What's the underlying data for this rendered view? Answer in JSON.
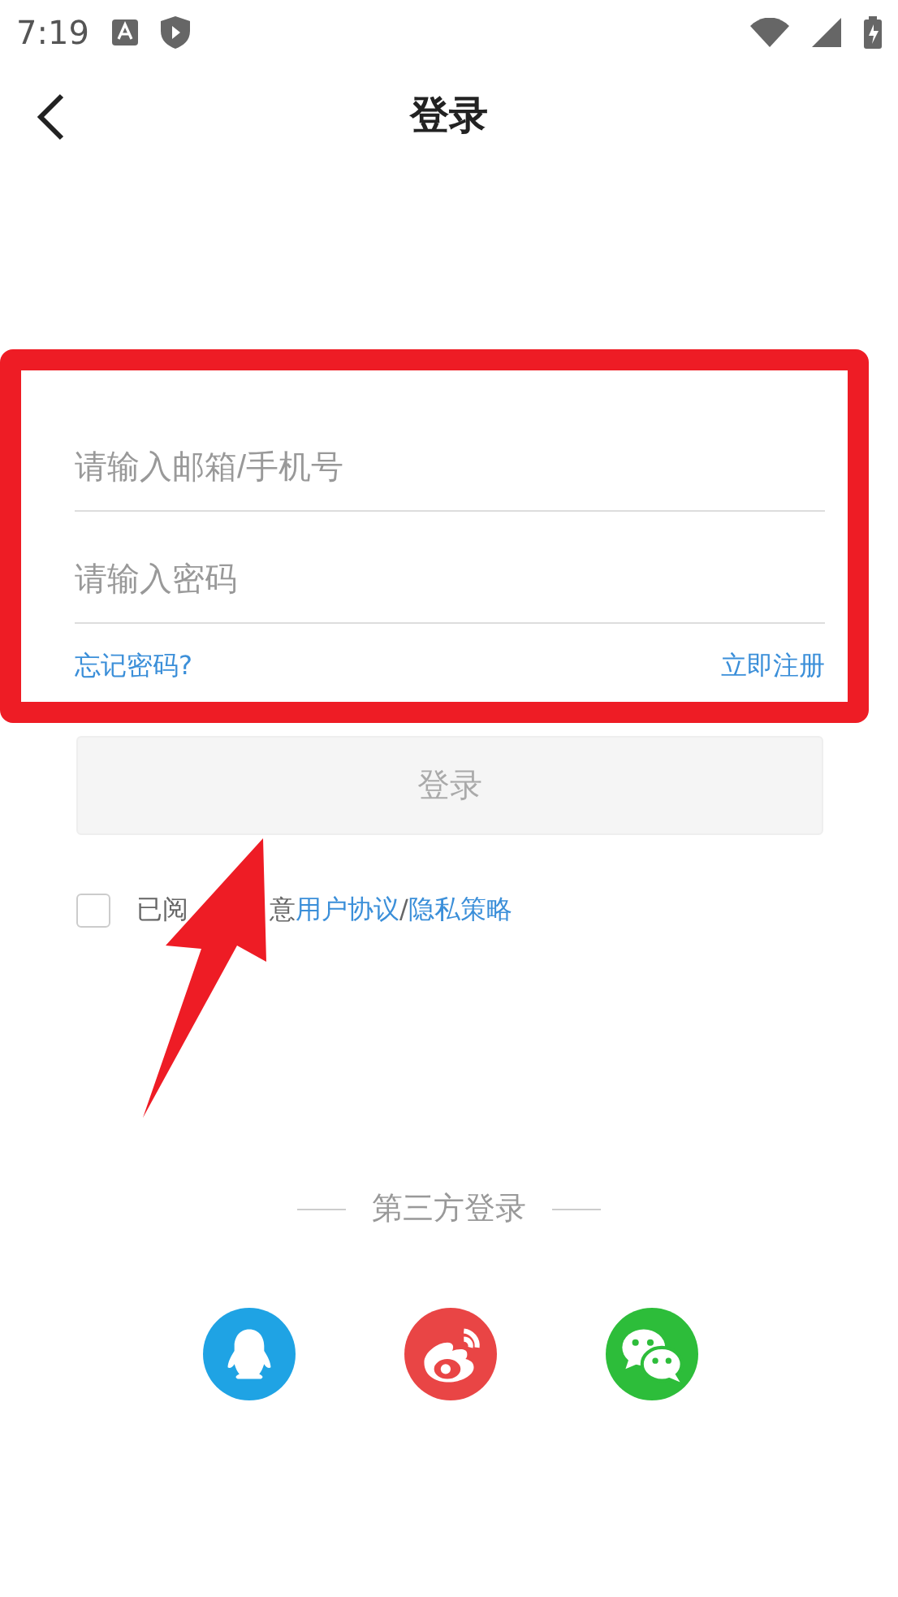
{
  "status_bar": {
    "time": "7:19"
  },
  "header": {
    "title": "登录"
  },
  "form": {
    "fields": [
      {
        "placeholder": "请输入邮箱/手机号"
      },
      {
        "placeholder": "请输入密码"
      }
    ],
    "forgot_link": "忘记密码?",
    "register_link": "立即注册"
  },
  "login_button": {
    "label": "登录",
    "disabled": true
  },
  "agreement": {
    "checked": false,
    "text_before": "已阅",
    "text_after": "意",
    "links": [
      "用户协议",
      "隐私策略"
    ],
    "separator": "/"
  },
  "third_party": {
    "title": "第三方登录",
    "providers": [
      {
        "kind": "qq",
        "color": "#1fa3e4"
      },
      {
        "kind": "weibo",
        "color": "#e94545"
      },
      {
        "kind": "wechat",
        "color": "#2dbd3a"
      }
    ]
  }
}
